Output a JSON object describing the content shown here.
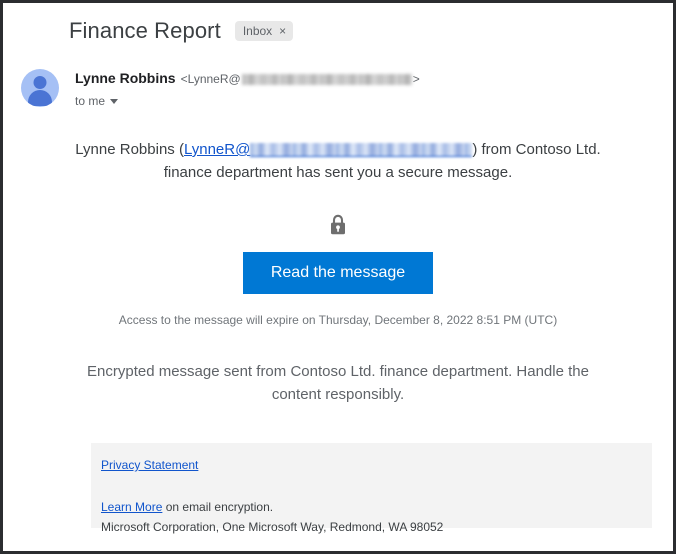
{
  "email": {
    "subject": "Finance Report",
    "label": {
      "text": "Inbox",
      "close": "×"
    },
    "sender": {
      "name": "Lynne Robbins",
      "address_prefix": "<LynneR@",
      "address_suffix": ">",
      "address_redacted": true,
      "recipients": "to me"
    },
    "body": {
      "intro_before_link": "Lynne Robbins (",
      "intro_link_text": "LynneR@",
      "intro_after_link": ") from Contoso Ltd. finance department has sent you a secure message.",
      "lock_icon": "lock-icon",
      "read_button": "Read the message",
      "expiry_notice": "Access to the message will expire on Thursday, December 8, 2022 8:51 PM (UTC)",
      "outro": "Encrypted message sent from Contoso Ltd. finance department. Handle the content responsibly."
    },
    "footer": {
      "privacy_link": "Privacy Statement",
      "learn_more_link": "Learn More",
      "learn_more_rest": " on email encryption.",
      "company_address": "Microsoft Corporation, One Microsoft Way, Redmond, WA 98052"
    }
  },
  "colors": {
    "button_blue": "#0078d4",
    "link_blue": "#1155cc",
    "avatar_bg": "#a5c0f5",
    "avatar_fg": "#4a74d4",
    "chip_bg": "#e8e8e8",
    "footer_bg": "#f3f3f3",
    "frame": "#2b2d30"
  }
}
